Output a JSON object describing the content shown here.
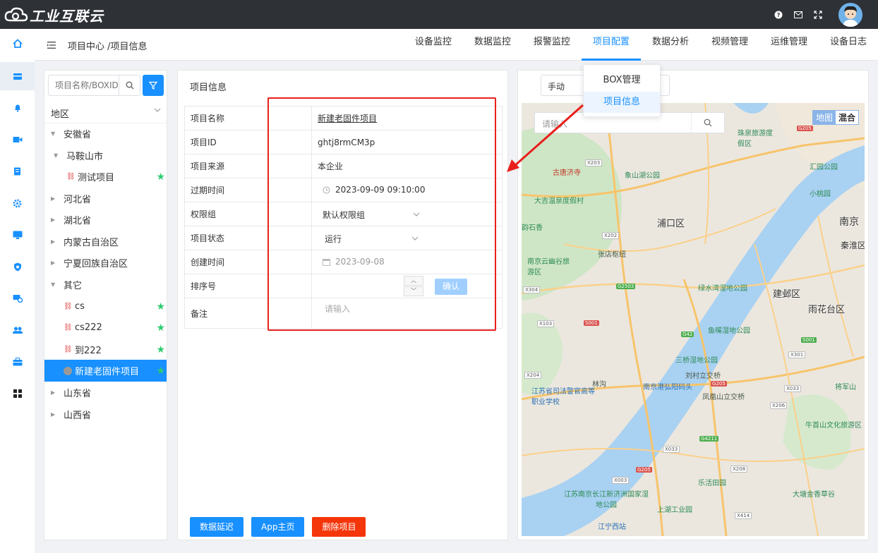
{
  "app": {
    "title": "工业互联云"
  },
  "breadcrumb": {
    "text": "项目中心 /项目信息"
  },
  "nav": {
    "items": [
      "设备监控",
      "数据监控",
      "报警监控",
      "项目配置",
      "数据分析",
      "视频管理",
      "运维管理",
      "设备日志"
    ],
    "active": "项目配置"
  },
  "dropdown": {
    "items": [
      "BOX管理",
      "项目信息"
    ],
    "active": "项目信息"
  },
  "sidebar": {
    "icons": [
      "home-icon",
      "box-icon",
      "bell-icon",
      "video-icon",
      "document-icon",
      "gear-icon",
      "monitor-icon",
      "shield-icon",
      "device-settings-icon",
      "users-icon",
      "toolbox-icon",
      "grid-icon"
    ]
  },
  "left": {
    "search_placeholder": "项目名称/BOXID",
    "region_label": "地区",
    "tree": [
      {
        "label": "安徽省",
        "level": 0,
        "expanded": true
      },
      {
        "label": "马鞍山市",
        "level": 1,
        "expanded": true
      },
      {
        "label": "测试项目",
        "level": 2,
        "starred": true
      },
      {
        "label": "河北省",
        "level": 0
      },
      {
        "label": "湖北省",
        "level": 0
      },
      {
        "label": "内蒙古自治区",
        "level": 0
      },
      {
        "label": "宁夏回族自治区",
        "level": 0
      },
      {
        "label": "其它",
        "level": 0,
        "expanded": true
      },
      {
        "label": "cs",
        "level": 1,
        "starred": true
      },
      {
        "label": "cs222",
        "level": 1,
        "starred": true
      },
      {
        "label": "到222",
        "level": 1,
        "starred": true
      },
      {
        "label": "新建老固件项目",
        "level": 1,
        "starred": true,
        "selected": true
      },
      {
        "label": "山东省",
        "level": 0
      },
      {
        "label": "山西省",
        "level": 0
      }
    ]
  },
  "form": {
    "section_title": "项目信息",
    "rows": {
      "name": {
        "label": "项目名称",
        "value": "新建老固件项目"
      },
      "id": {
        "label": "项目ID",
        "value": "ghtj8rmCM3p"
      },
      "source": {
        "label": "项目来源",
        "value": "本企业"
      },
      "expire": {
        "label": "过期时间",
        "value": "2023-09-09 09:10:00"
      },
      "group": {
        "label": "权限组",
        "value": "默认权限组"
      },
      "status": {
        "label": "项目状态",
        "value": "运行"
      },
      "created": {
        "label": "创建时间",
        "value": "2023-09-08"
      },
      "sort": {
        "label": "排序号",
        "confirm": "确认"
      },
      "note": {
        "label": "备注",
        "placeholder": "请输入"
      }
    },
    "buttons": {
      "delay": "数据延迟",
      "app_home": "App主页",
      "delete": "删除项目"
    }
  },
  "map": {
    "mode": "手动",
    "search_placeholder": "请输入",
    "toggle": [
      "地图",
      "混合"
    ],
    "labels": [
      "南京",
      "秦淮区",
      "浦口区",
      "建邺区",
      "雨花台区",
      "象山湖公园",
      "大吉温泉度假村",
      "古唐济寺",
      "张店枢纽",
      "南京云幽谷旅游区",
      "绿水湾湿地公园",
      "鱼嘴湿地公园",
      "三桥湿地公园",
      "刘村立交桥",
      "凤凰山立交桥",
      "南京港弘阳码头",
      "江苏省司法警官高等职业学校",
      "牛首山文化旅游区",
      "将军山",
      "乐活田园",
      "大塘金香草谷",
      "江苏南京长江新济洲国家湿地公园",
      "江宁西站",
      "上湖工业园",
      "小桃园",
      "珠泉旅游度假区",
      "汇园公园",
      "林沟",
      "韵石香"
    ]
  },
  "colors": {
    "accent": "#1890ff",
    "danger": "#f5350a",
    "topbar": "#2e3136",
    "highlight": "#e8201c"
  }
}
